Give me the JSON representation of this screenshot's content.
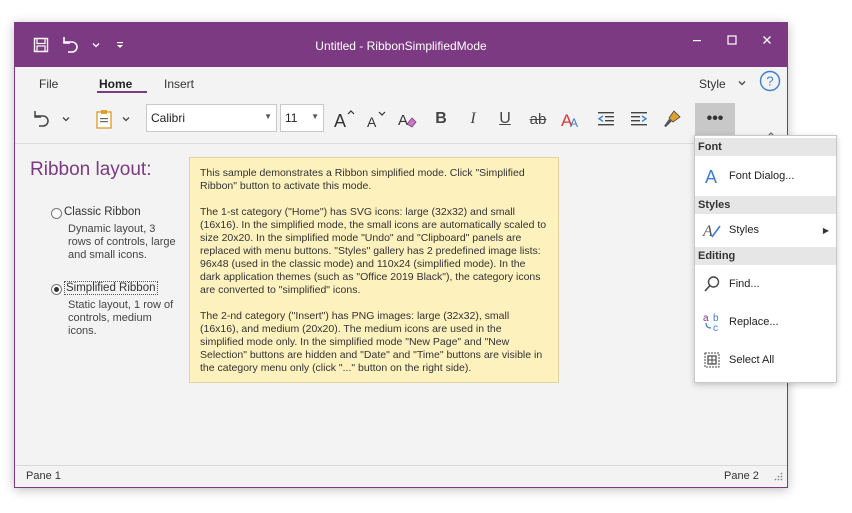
{
  "window": {
    "title": "Untitled - RibbonSimplifiedMode",
    "accent": "#7c3a82"
  },
  "quick_access": {
    "icons": [
      "save-icon",
      "undo-icon",
      "chevron-down-icon",
      "customize-icon"
    ]
  },
  "tabs": [
    {
      "label": "File"
    },
    {
      "label": "Home"
    },
    {
      "label": "Insert"
    }
  ],
  "style_menu": {
    "label": "Style"
  },
  "ribbon": {
    "font_name": "Calibri",
    "font_size": "11",
    "buttons": [
      "undo",
      "paste",
      "grow-font",
      "shrink-font",
      "clear-format",
      "bold",
      "italic",
      "underline",
      "strikethrough",
      "font-color",
      "outdent",
      "indent",
      "format-painter",
      "more"
    ],
    "more_label": "•••"
  },
  "content": {
    "heading": "Ribbon layout:",
    "options": [
      {
        "label": "Classic Ribbon",
        "desc": "Dynamic layout, 3 rows of controls, large and small icons.",
        "selected": false
      },
      {
        "label": "Simplified Ribbon",
        "desc": "Static layout, 1 row of controls, medium icons.",
        "selected": true
      }
    ],
    "note": [
      "This sample demonstrates a Ribbon simplified mode. Click \"Simplified Ribbon\" button to activate this mode.",
      "The 1-st category (\"Home\") has SVG icons: large (32x32) and small (16x16). In the simplified mode, the small icons are automatically scaled to size 20x20. In the simplified mode \"Undo\" and \"Clipboard\" panels are replaced with menu buttons. \"Styles\" gallery has 2 predefined image lists: 96x48 (used in the classic mode) and 110x24 (simplified mode). In the dark application themes (such as \"Office 2019 Black\"), the category icons are converted to \"simplified\" icons.",
      "The 2-nd category (\"Insert\") has PNG images: large (32x32), small (16x16), and medium (20x20). The medium icons are used in the simplified mode only. In the simplified mode \"New Page\" and \"New Selection\" buttons are hidden and \"Date\" and \"Time\" buttons are visible in the category menu only (click \"...\" button on the right side)."
    ]
  },
  "status": {
    "left": "Pane 1",
    "right": "Pane 2"
  },
  "popup": {
    "font_header": "Font",
    "font_dialog": "Font Dialog...",
    "styles_header": "Styles",
    "styles_item": "Styles",
    "editing_header": "Editing",
    "find": "Find...",
    "replace": "Replace...",
    "select_all": "Select All"
  }
}
